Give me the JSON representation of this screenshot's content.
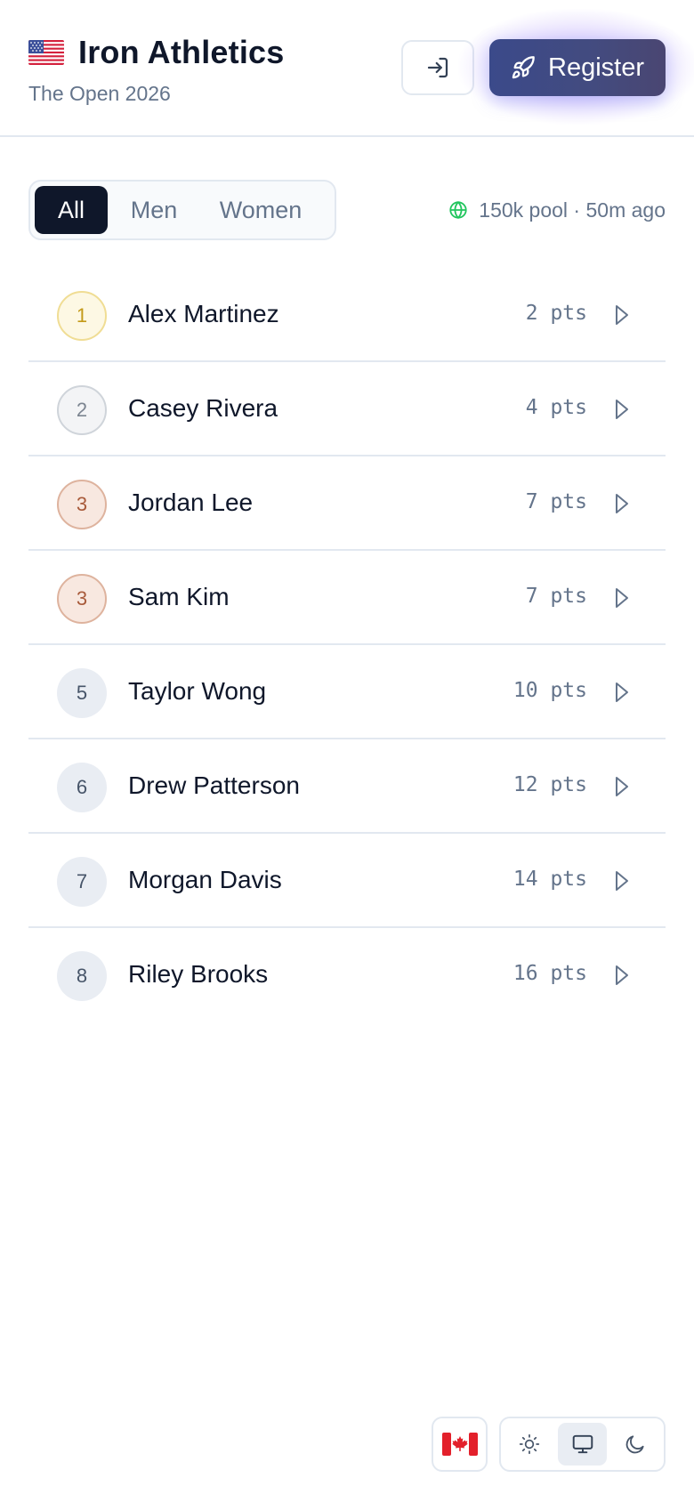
{
  "header": {
    "brand_title": "Iron Athletics",
    "brand_subtitle": "The Open 2026",
    "register_label": "Register",
    "flag_icon": "us-flag-icon",
    "login_icon": "sign-in-icon",
    "register_icon": "rocket-icon"
  },
  "filters": {
    "tabs": [
      {
        "label": "All",
        "active": true
      },
      {
        "label": "Men",
        "active": false
      },
      {
        "label": "Women",
        "active": false
      }
    ],
    "pool_text": "150k pool · 50m ago",
    "pool_icon": "globe-icon"
  },
  "leaderboard": [
    {
      "rank": "1",
      "name": "Alex Martinez",
      "points": "2 pts",
      "medal": "gold"
    },
    {
      "rank": "2",
      "name": "Casey Rivera",
      "points": "4 pts",
      "medal": "silver"
    },
    {
      "rank": "3",
      "name": "Jordan Lee",
      "points": "7 pts",
      "medal": "bronze"
    },
    {
      "rank": "3",
      "name": "Sam Kim",
      "points": "7 pts",
      "medal": "bronze"
    },
    {
      "rank": "5",
      "name": "Taylor Wong",
      "points": "10 pts",
      "medal": "none"
    },
    {
      "rank": "6",
      "name": "Drew Patterson",
      "points": "12 pts",
      "medal": "none"
    },
    {
      "rank": "7",
      "name": "Morgan Davis",
      "points": "14 pts",
      "medal": "none"
    },
    {
      "rank": "8",
      "name": "Riley Brooks",
      "points": "16 pts",
      "medal": "none"
    }
  ],
  "footer": {
    "locale_icon": "canada-flag-icon",
    "theme_options": [
      "light",
      "system",
      "dark"
    ],
    "theme_selected": "system"
  },
  "colors": {
    "primary": "#0f172a",
    "muted": "#64748b",
    "register_bg": "#434b7f",
    "gold": "#c49a19",
    "silver": "#7c8591",
    "bronze": "#a85a3a",
    "online": "#22c55e"
  }
}
